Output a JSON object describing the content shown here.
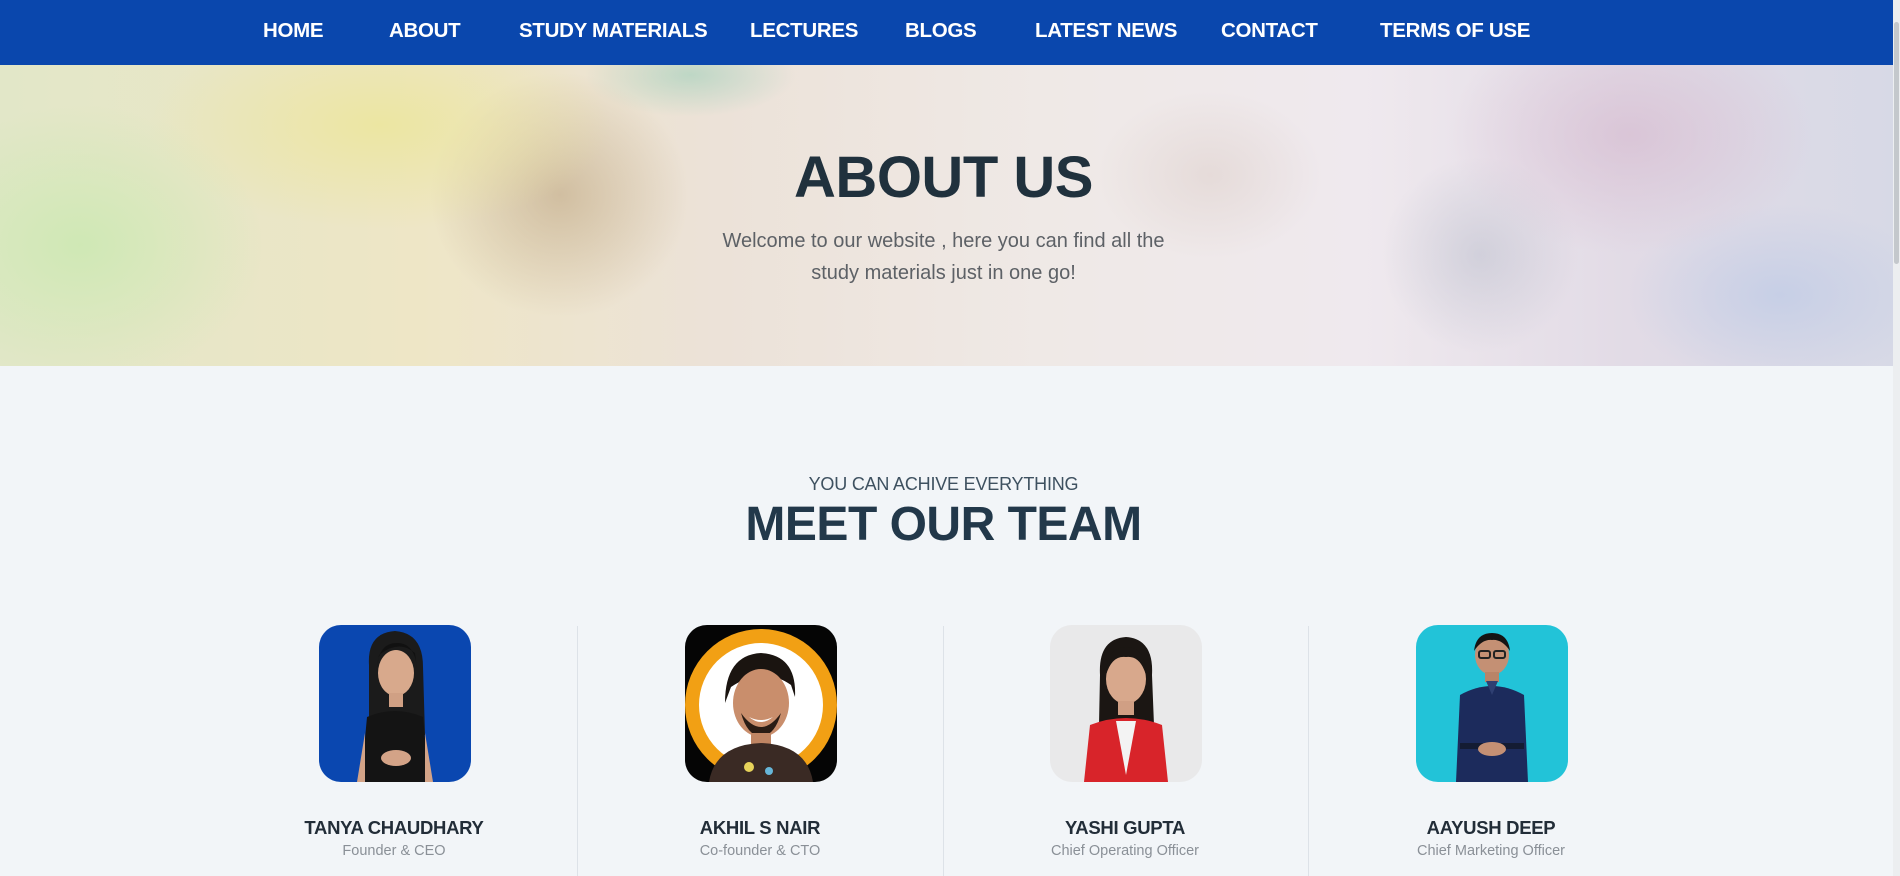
{
  "nav": {
    "items": [
      {
        "label": "HOME"
      },
      {
        "label": "ABOUT"
      },
      {
        "label": "STUDY MATERIALS"
      },
      {
        "label": "LECTURES"
      },
      {
        "label": "BLOGS"
      },
      {
        "label": "LATEST NEWS"
      },
      {
        "label": "CONTACT"
      },
      {
        "label": "TERMS OF USE"
      }
    ],
    "background": "#0a47ad"
  },
  "hero": {
    "title": "ABOUT US",
    "subtitle": "Welcome to our website , here you can find all the study materials just in one go!"
  },
  "team": {
    "kicker": "YOU CAN ACHIVE EVERYTHING",
    "title": "MEET OUR TEAM",
    "members": [
      {
        "name": "TANYA CHAUDHARY",
        "role": "Founder & CEO",
        "photo_bg": "#0a47b0"
      },
      {
        "name": "AKHIL S NAIR",
        "role": "Co-founder & CTO",
        "photo_bg": "#f59a0c"
      },
      {
        "name": "YASHI GUPTA",
        "role": "Chief Operating Officer",
        "photo_bg": "#e9e9ea"
      },
      {
        "name": "AAYUSH DEEP",
        "role": "Chief Marketing Officer",
        "photo_bg": "#22c3d8"
      }
    ]
  }
}
